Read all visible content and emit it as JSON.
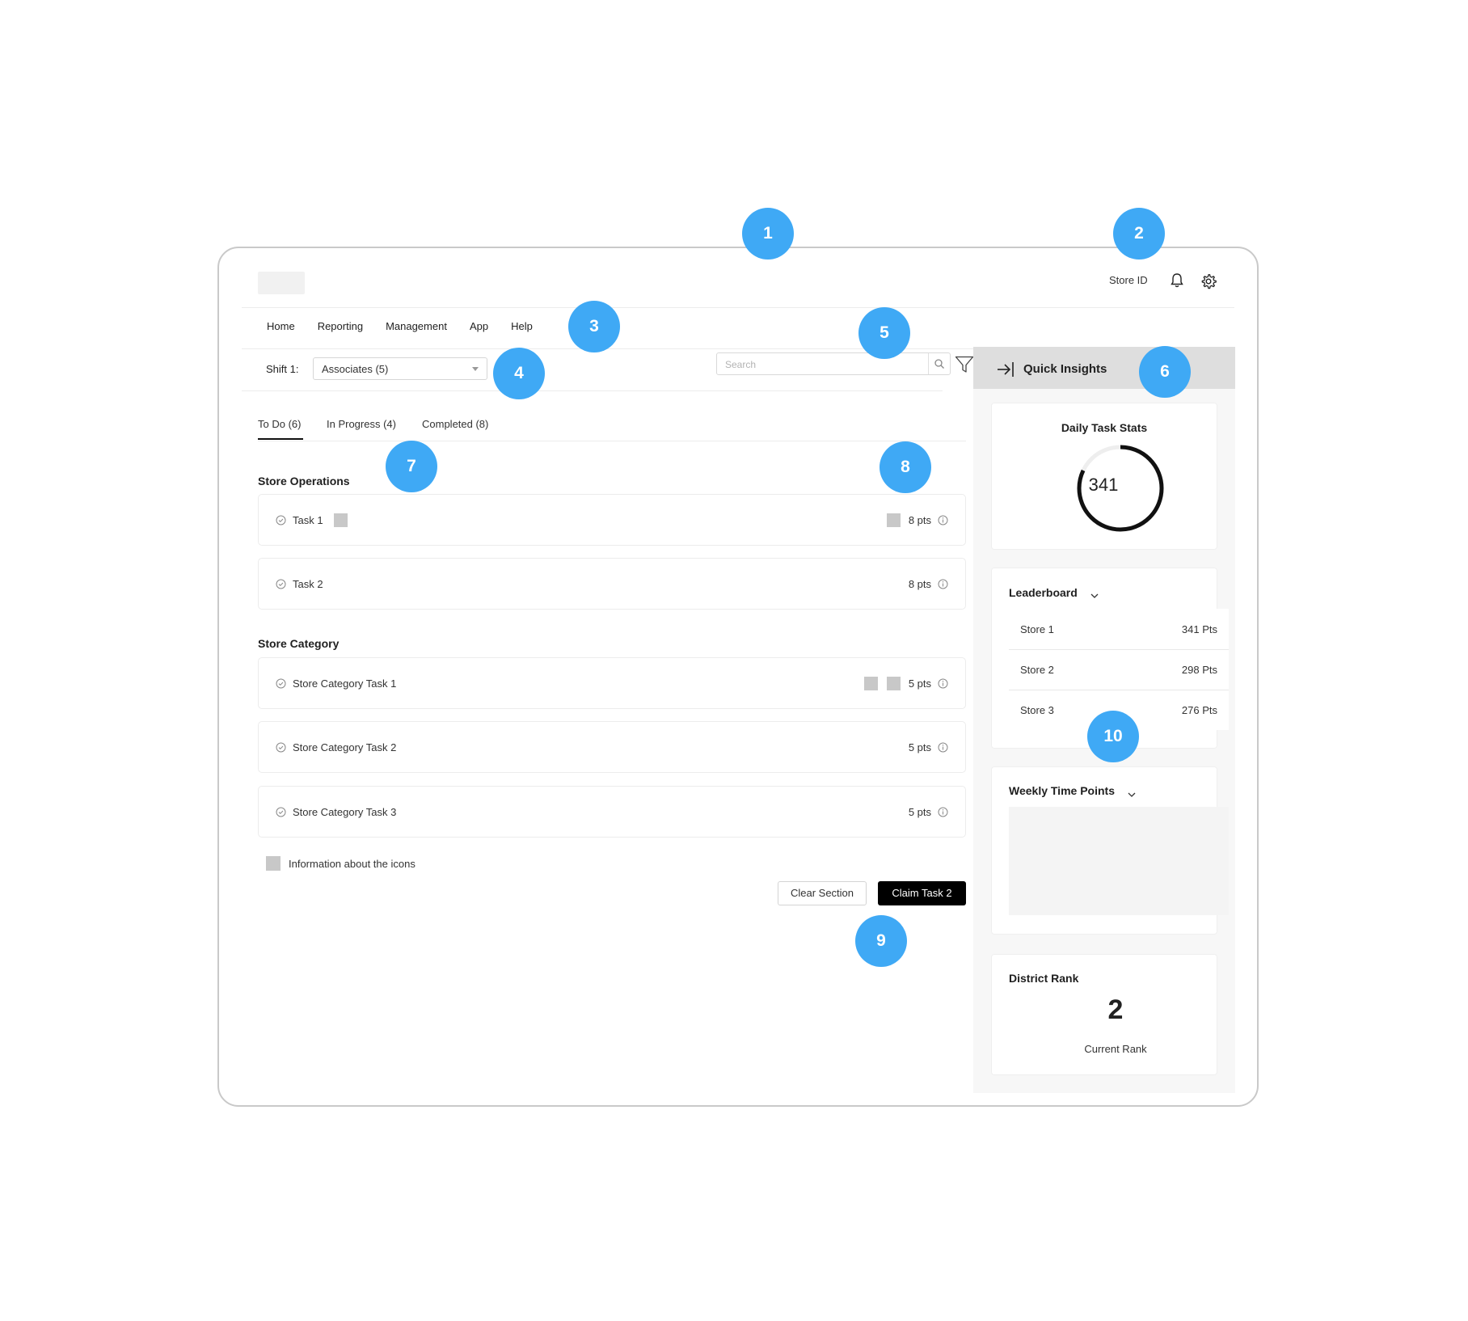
{
  "header": {
    "store_id": "Store ID",
    "bell_icon": "bell-icon",
    "settings_icon": "gear-icon"
  },
  "nav": {
    "items": [
      "Home",
      "Reporting",
      "Management",
      "App",
      "Help"
    ]
  },
  "filters": {
    "shift_label": "Shift 1:",
    "associates_selected": "Associates (5)",
    "search_placeholder": "Search"
  },
  "tabs": [
    {
      "label": "To Do (6)",
      "active": true
    },
    {
      "label": "In Progress (4)",
      "active": false
    },
    {
      "label": "Completed (8)",
      "active": false
    }
  ],
  "sections": [
    {
      "title": "Store Operations",
      "tasks": [
        {
          "label": "Task 1",
          "points": "8 pts"
        },
        {
          "label": "Task 2",
          "points": "8 pts"
        }
      ]
    },
    {
      "title": "Store Category",
      "tasks": [
        {
          "label": "Store Category Task 1",
          "points": "5 pts"
        },
        {
          "label": "Store Category Task 2",
          "points": "5 pts"
        },
        {
          "label": "Store Category Task 3",
          "points": "5 pts"
        }
      ]
    }
  ],
  "legend": {
    "text": "Information about the icons"
  },
  "actions": {
    "clear": "Clear Section",
    "claim": "Claim Task 2"
  },
  "insights": {
    "title": "Quick Insights",
    "daily_task_stats": {
      "title": "Daily Task Stats",
      "value": "341",
      "progress": 0.82
    },
    "leaderboard": {
      "title": "Leaderboard",
      "rows": [
        {
          "store": "Store 1",
          "points": "341 Pts"
        },
        {
          "store": "Store 2",
          "points": "298 Pts"
        },
        {
          "store": "Store 3",
          "points": "276 Pts"
        }
      ]
    },
    "weekly_time_points": {
      "title": "Weekly Time Points"
    },
    "district_rank": {
      "title": "District Rank",
      "value": "2",
      "caption": "Current Rank"
    }
  },
  "annotations": [
    "1",
    "2",
    "3",
    "4",
    "5",
    "6",
    "7",
    "8",
    "9",
    "10"
  ],
  "colors": {
    "annotation": "#3fa9f5",
    "primary_button": "#000000"
  }
}
